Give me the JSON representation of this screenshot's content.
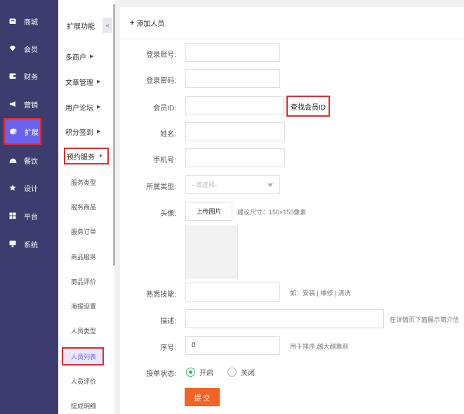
{
  "nav": {
    "items": [
      {
        "label": "商城",
        "icon": "shop-icon",
        "active": false
      },
      {
        "label": "会员",
        "icon": "diamond-icon",
        "active": false
      },
      {
        "label": "财务",
        "icon": "wallet-icon",
        "active": false
      },
      {
        "label": "营销",
        "icon": "megaphone-icon",
        "active": false
      },
      {
        "label": "扩展",
        "icon": "cube-icon",
        "active": true
      },
      {
        "label": "餐饮",
        "icon": "dish-icon",
        "active": false
      },
      {
        "label": "设计",
        "icon": "star-icon",
        "active": false
      },
      {
        "label": "平台",
        "icon": "grid-icon",
        "active": false
      },
      {
        "label": "系统",
        "icon": "monitor-icon",
        "active": false
      }
    ]
  },
  "submenu": {
    "title": "扩展功能",
    "collapse_glyph": "«",
    "groups": [
      "多商户",
      "文章管理",
      "用户论坛",
      "积分签到",
      "预约服务"
    ],
    "items": [
      "服务类型",
      "服务商品",
      "服务订单",
      "商品服务",
      "商品评价",
      "海报设置",
      "人员类型",
      "人员列表",
      "人员评价",
      "提成明细"
    ],
    "active_item": "人员列表"
  },
  "form": {
    "header": "添加人员",
    "account_label": "登录账号:",
    "password_label": "登录密码:",
    "member_id_label": "会员ID:",
    "find_member_button": "查找会员ID",
    "name_label": "姓名:",
    "phone_label": "手机号:",
    "type_label": "所属类型:",
    "type_placeholder": "--请选择--",
    "avatar_label": "头像:",
    "upload_button": "上传图片",
    "avatar_hint": "建议尺寸：150×150像素",
    "skills_label": "熟悉技能:",
    "skills_hint": "如：安装 | 维修 | 清洗",
    "desc_label": "描述:",
    "desc_hint": "在详情页下面展示简介信",
    "sort_label": "序号:",
    "sort_value": "0",
    "sort_hint": "用于排序,越大越靠前",
    "status_label": "接单状态:",
    "status_on": "开启",
    "status_off": "关闭",
    "submit": "提 交"
  },
  "colors": {
    "nav_bg": "#3c3d6e",
    "accent": "#6b63f0",
    "highlight_border": "#e02d2d",
    "submit_bg": "#f36326",
    "radio_on": "#2eb872"
  }
}
